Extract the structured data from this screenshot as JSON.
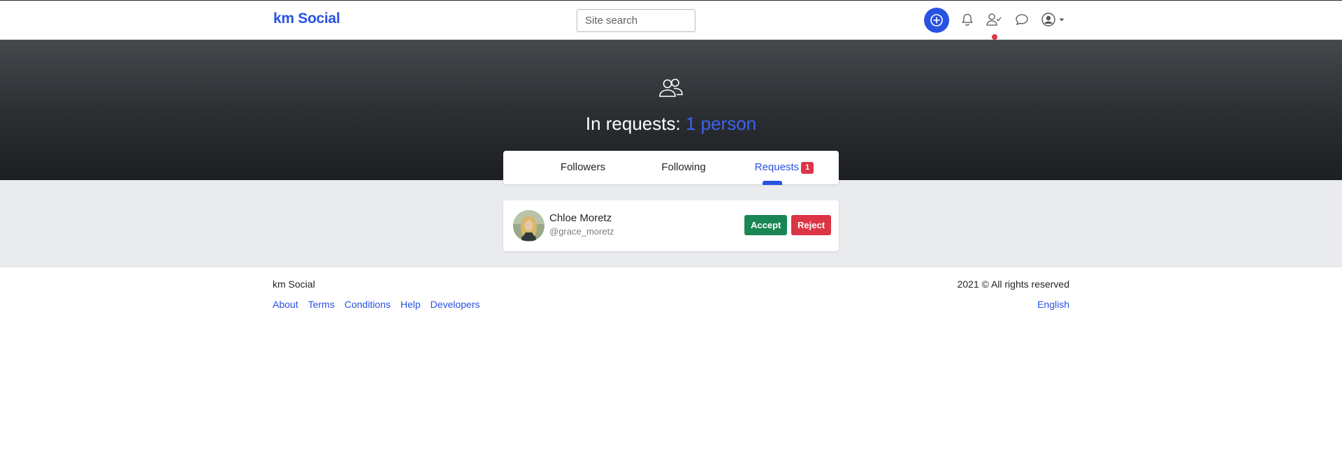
{
  "header": {
    "brand": "km Social",
    "search_placeholder": "Site search",
    "icons": [
      "plus-circle-icon",
      "bell-icon",
      "person-check-icon",
      "chat-icon",
      "user-circle-icon",
      "caret-down-icon"
    ],
    "accent": "#2952e3",
    "notification_dot_color": "#dc3545"
  },
  "hero": {
    "icon": "people-icon",
    "title_prefix": "In requests:",
    "title_count": "1 person"
  },
  "tabs": [
    {
      "label": "Followers"
    },
    {
      "label": "Following"
    },
    {
      "label": "Requests",
      "badge": "1",
      "active": true
    }
  ],
  "requests": [
    {
      "name": "Chloe Moretz",
      "handle": "@grace_moretz",
      "accept_label": "Accept",
      "reject_label": "Reject"
    }
  ],
  "footer": {
    "brand": "km Social",
    "copyright": "2021 © All rights reserved",
    "links": [
      "About",
      "Terms",
      "Conditions",
      "Help",
      "Developers"
    ],
    "language": "English"
  },
  "colors": {
    "accept": "#198754",
    "reject": "#dc3545",
    "hero_dark": "#1c1f22",
    "page_bg": "#e9ebee"
  }
}
